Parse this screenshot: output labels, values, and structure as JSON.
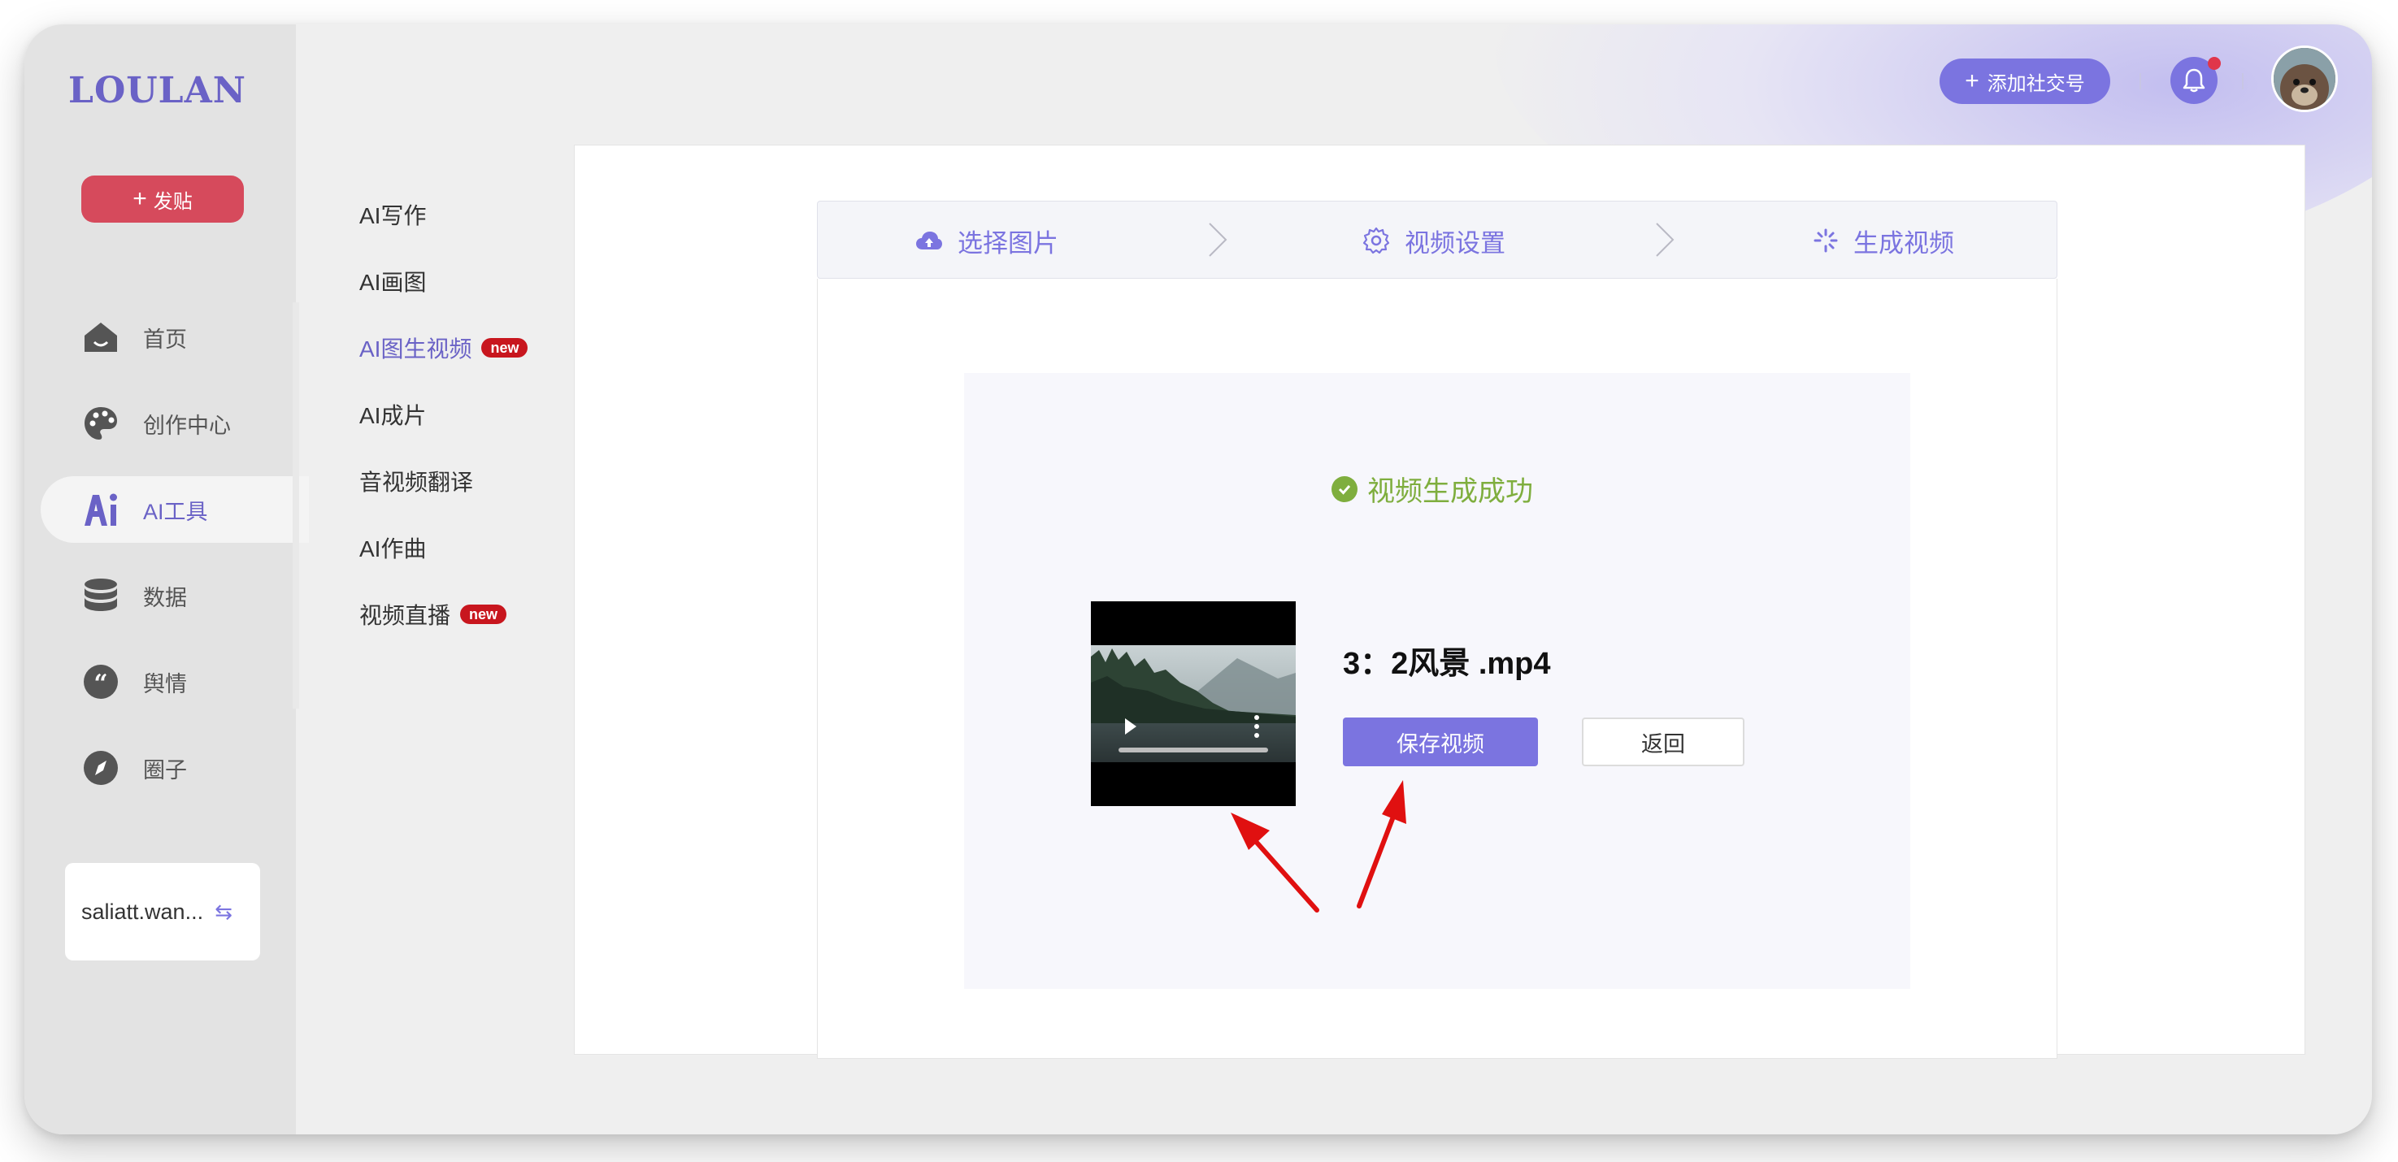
{
  "app": {
    "logo": "LOULAN",
    "accent_color": "#7b74e0",
    "post_color": "#d64a5c"
  },
  "sidebar": {
    "post_button": {
      "label": "发贴",
      "icon": "plus-icon"
    },
    "items": [
      {
        "label": "首页",
        "icon": "home-icon",
        "active": false
      },
      {
        "label": "创作中心",
        "icon": "palette-icon",
        "active": false
      },
      {
        "label": "AI工具",
        "icon": "ai-icon",
        "active": true
      },
      {
        "label": "数据",
        "icon": "database-icon",
        "active": false
      },
      {
        "label": "舆情",
        "icon": "quote-icon",
        "active": false
      },
      {
        "label": "圈子",
        "icon": "compass-icon",
        "active": false
      }
    ],
    "account": {
      "name": "saliatt.wan...",
      "icon": "swap-icon"
    }
  },
  "subnav": {
    "items": [
      {
        "label": "AI写作",
        "badge": ""
      },
      {
        "label": "AI画图",
        "badge": ""
      },
      {
        "label": "AI图生视频",
        "badge": "new",
        "active": true
      },
      {
        "label": "AI成片",
        "badge": ""
      },
      {
        "label": "音视频翻译",
        "badge": ""
      },
      {
        "label": "AI作曲",
        "badge": ""
      },
      {
        "label": "视频直播",
        "badge": "new"
      }
    ]
  },
  "header": {
    "add_social_label": "添加社交号",
    "bell_icon": "bell-icon",
    "has_notification": true,
    "avatar_icon": "avatar"
  },
  "steps": [
    {
      "label": "选择图片",
      "icon": "cloud-upload-icon"
    },
    {
      "label": "视频设置",
      "icon": "gear-icon"
    },
    {
      "label": "生成视频",
      "icon": "loading-icon"
    }
  ],
  "result": {
    "status_text": "视频生成成功",
    "status_color": "#7fae3e",
    "filename": "3：2风景 .mp4",
    "save_label": "保存视频",
    "back_label": "返回"
  }
}
